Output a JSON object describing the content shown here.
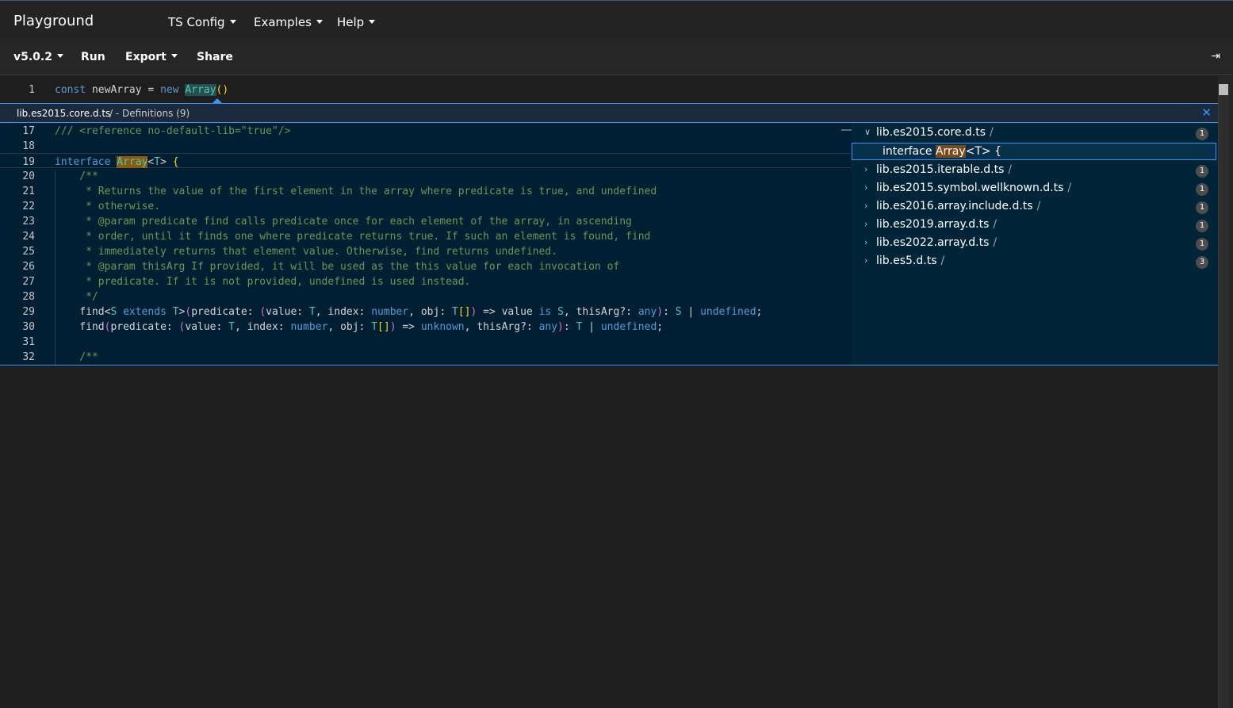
{
  "topnav": {
    "brand": "Playground",
    "menus": [
      {
        "label": "TS Config"
      },
      {
        "label": "Examples"
      },
      {
        "label": "Help"
      }
    ]
  },
  "toolbar": {
    "version": "v5.0.2",
    "run": "Run",
    "export": "Export",
    "share": "Share",
    "sidebar_icon": "collapse-sidebar-icon"
  },
  "editor": {
    "line1": {
      "num": "1",
      "const": "const",
      "name": " newArray = ",
      "new": "new",
      "space": " ",
      "array": "Array",
      "parens": "()"
    }
  },
  "peek": {
    "file": "lib.es2015.core.d.ts",
    "title": "/ - Definitions (9)",
    "close_icon": "close-icon",
    "lines": [
      {
        "n": "17",
        "t": "/// <reference no-default-lib=\"true\"/>"
      },
      {
        "n": "18",
        "t": ""
      },
      {
        "n": "19",
        "t": "interface Array<T> {"
      },
      {
        "n": "20",
        "t": "    /**"
      },
      {
        "n": "21",
        "t": "     * Returns the value of the first element in the array where predicate is true, and undefined"
      },
      {
        "n": "22",
        "t": "     * otherwise."
      },
      {
        "n": "23",
        "t": "     * @param predicate find calls predicate once for each element of the array, in ascending"
      },
      {
        "n": "24",
        "t": "     * order, until it finds one where predicate returns true. If such an element is found, find"
      },
      {
        "n": "25",
        "t": "     * immediately returns that element value. Otherwise, find returns undefined."
      },
      {
        "n": "26",
        "t": "     * @param thisArg If provided, it will be used as the this value for each invocation of"
      },
      {
        "n": "27",
        "t": "     * predicate. If it is not provided, undefined is used instead."
      },
      {
        "n": "28",
        "t": "     */"
      },
      {
        "n": "29",
        "t": "    find<S extends T>(predicate: (value: T, index: number, obj: T[]) => value is S, thisArg?: any): S | undefined;"
      },
      {
        "n": "30",
        "t": "    find(predicate: (value: T, index: number, obj: T[]) => unknown, thisArg?: any): T | undefined;"
      },
      {
        "n": "31",
        "t": ""
      },
      {
        "n": "32",
        "t": "    /**"
      }
    ],
    "tree": [
      {
        "file": "lib.es2015.core.d.ts",
        "count": "1",
        "expanded": true
      },
      {
        "file": "lib.es2015.iterable.d.ts",
        "count": "1"
      },
      {
        "file": "lib.es2015.symbol.wellknown.d.ts",
        "count": "1"
      },
      {
        "file": "lib.es2016.array.include.d.ts",
        "count": "1"
      },
      {
        "file": "lib.es2019.array.d.ts",
        "count": "1"
      },
      {
        "file": "lib.es2022.array.d.ts",
        "count": "1"
      },
      {
        "file": "lib.es5.d.ts",
        "count": "3"
      }
    ],
    "selected_ref": {
      "pre": "interface ",
      "word": "Array",
      "post": "<T> {"
    },
    "slash": "/"
  },
  "colors": {
    "accent": "#3794ff",
    "peek_bg": "#001f33",
    "keyword": "#569cd6",
    "type": "#4ec9b0",
    "comment": "#6a9955"
  }
}
